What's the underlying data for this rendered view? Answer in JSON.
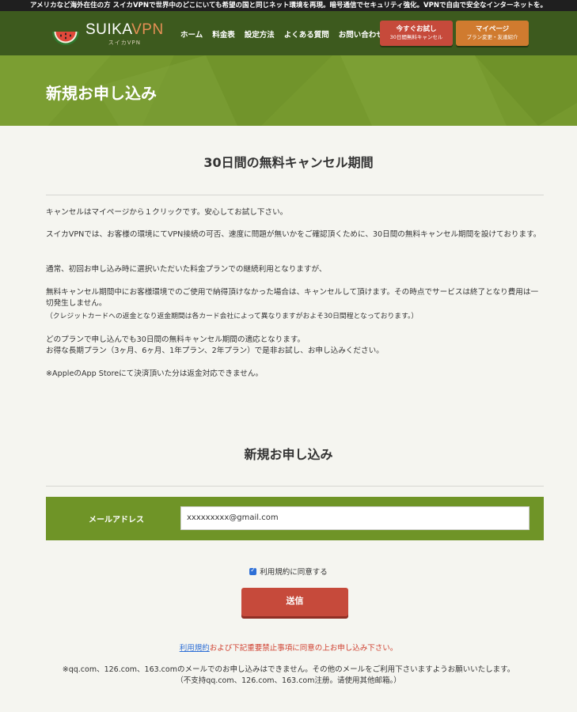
{
  "topbar": {
    "text": "アメリカなど海外在住の方 スイカVPNで世界中のどこにいても希望の国と同じネット環境を再現。暗号通信でセキュリティ強化。VPNで自由で安全なインターネットを。"
  },
  "logo": {
    "main": "SUIKA",
    "accent": "VPN",
    "sub": "スイカVPN"
  },
  "nav": {
    "items": [
      "ホーム",
      "料金表",
      "設定方法",
      "よくある質問",
      "お問い合わせ"
    ]
  },
  "header_buttons": {
    "trial": {
      "line1": "今すぐお試し",
      "line2": "30日間無料キャンセル"
    },
    "mypage": {
      "line1": "マイページ",
      "line2": "プラン変更・友達紹介"
    }
  },
  "hero": {
    "title": "新規お申し込み"
  },
  "cancel_section": {
    "title": "30日間の無料キャンセル期間",
    "p1": "キャンセルはマイページから１クリックです。安心してお試し下さい。",
    "p2": "スイカVPNでは、お客様の環境にてVPN接続の可否、速度に問題が無いかをご確認頂くために、30日間の無料キャンセル期間を設けております。",
    "p3": "通常、初回お申し込み時に選択いただいた料金プランでの継続利用となりますが、",
    "p4a": "無料キャンセル期間中にお客様環境でのご使用で納得頂けなかった場合は、キャンセルして頂けます。その時点でサービスは終了となり費用は一切発生しません。",
    "p4b": "（クレジットカードへの返金となり返金期間は各カード会社によって異なりますがおよそ30日間程となっております。）",
    "p5a": "どのプランで申し込んでも30日間の無料キャンセル期間の適応となります。",
    "p5b": "お得な長期プラン（3ヶ月、6ヶ月、1年プラン、2年プラン）で是非お試し、お申し込みください。",
    "p6": "※AppleのApp Storeにて決済頂いた分は返金対応できません。"
  },
  "form_section": {
    "title": "新規お申し込み",
    "email_label": "メールアドレス",
    "email_value": "xxxxxxxxx@gmail.com",
    "agree_label": "利用規約に同意する",
    "agree_checked": true,
    "submit_label": "送信",
    "terms_link": "利用規約",
    "terms_rest": "および下記重要禁止事項に同意の上お申し込み下さい。",
    "notice1": "※qq.com、126.com、163.comのメールでのお申し込みはできません。その他のメールをご利用下さいますようお願いいたします。",
    "notice2": "（不支持qq.com、126.com、163.com注册。请使用其他邮箱。）"
  },
  "colors": {
    "header_bg": "#3d5a1e",
    "hero_bg": "#76992e",
    "form_row_bg": "#6f9427",
    "accent_red": "#c64a3b",
    "accent_orange": "#d07b2f",
    "link_blue": "#2e6fd6"
  }
}
